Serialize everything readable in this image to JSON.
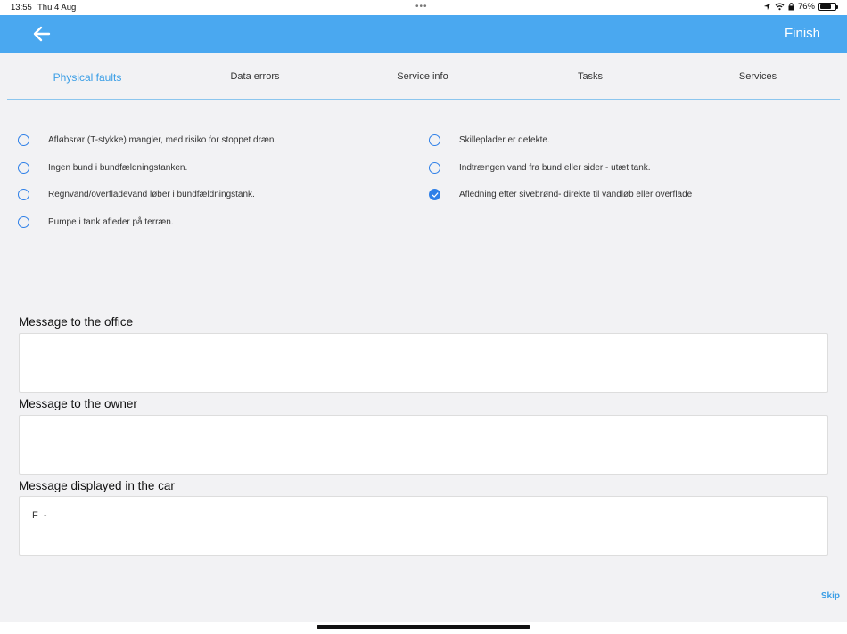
{
  "status_bar": {
    "time": "13:55",
    "date": "Thu 4 Aug",
    "battery": "76%",
    "battery_level": 0.76
  },
  "nav": {
    "finish_label": "Finish"
  },
  "tabs": [
    {
      "label": "Physical faults",
      "active": true
    },
    {
      "label": "Data errors",
      "active": false
    },
    {
      "label": "Service info",
      "active": false
    },
    {
      "label": "Tasks",
      "active": false
    },
    {
      "label": "Services",
      "active": false
    }
  ],
  "faults": {
    "left": [
      {
        "label": "Afløbsrør (T-stykke) mangler, med risiko for stoppet dræn.",
        "checked": false
      },
      {
        "label": "Ingen bund i bundfældningstanken.",
        "checked": false
      },
      {
        "label": "Regnvand/overfladevand løber i bundfældningstank.",
        "checked": false
      },
      {
        "label": "Pumpe i tank afleder på terræn.",
        "checked": false
      }
    ],
    "right": [
      {
        "label": "Skilleplader er defekte.",
        "checked": false
      },
      {
        "label": "Indtrængen vand fra bund eller sider - utæt tank.",
        "checked": false
      },
      {
        "label": "Afledning efter sivebrønd- direkte til vandløb eller overflade",
        "checked": true
      }
    ]
  },
  "messages": {
    "office_label": "Message to the office",
    "office_value": "",
    "owner_label": "Message to the owner",
    "owner_value": "",
    "car_label": "Message displayed in the car",
    "car_value": "F  -"
  },
  "skip_label": "Skip",
  "colors": {
    "accent": "#4aa8f0",
    "radio": "#2f80e8",
    "active_tab": "#3a9ee6"
  }
}
